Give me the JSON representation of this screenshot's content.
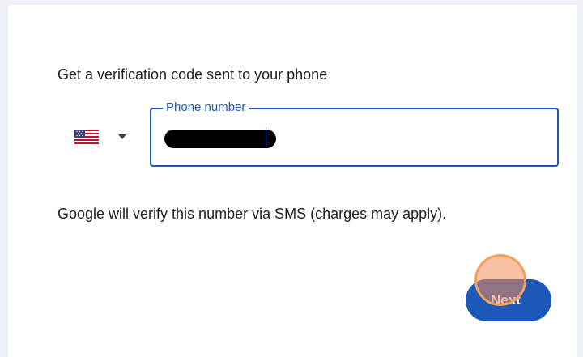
{
  "form": {
    "heading": "Get a verification code sent to your phone",
    "country": {
      "flag_icon": "us-flag-icon",
      "dropdown_icon": "caret-down-icon"
    },
    "phone": {
      "label": "Phone number",
      "value": "",
      "value_redacted": true
    },
    "note": "Google will verify this number via SMS (charges may apply).",
    "next_label": "Next"
  },
  "colors": {
    "accent": "#1a57b8",
    "button": "#1b58b8",
    "text": "#202124",
    "background": "#eef1f5",
    "click_marker": "#f2a15a"
  }
}
